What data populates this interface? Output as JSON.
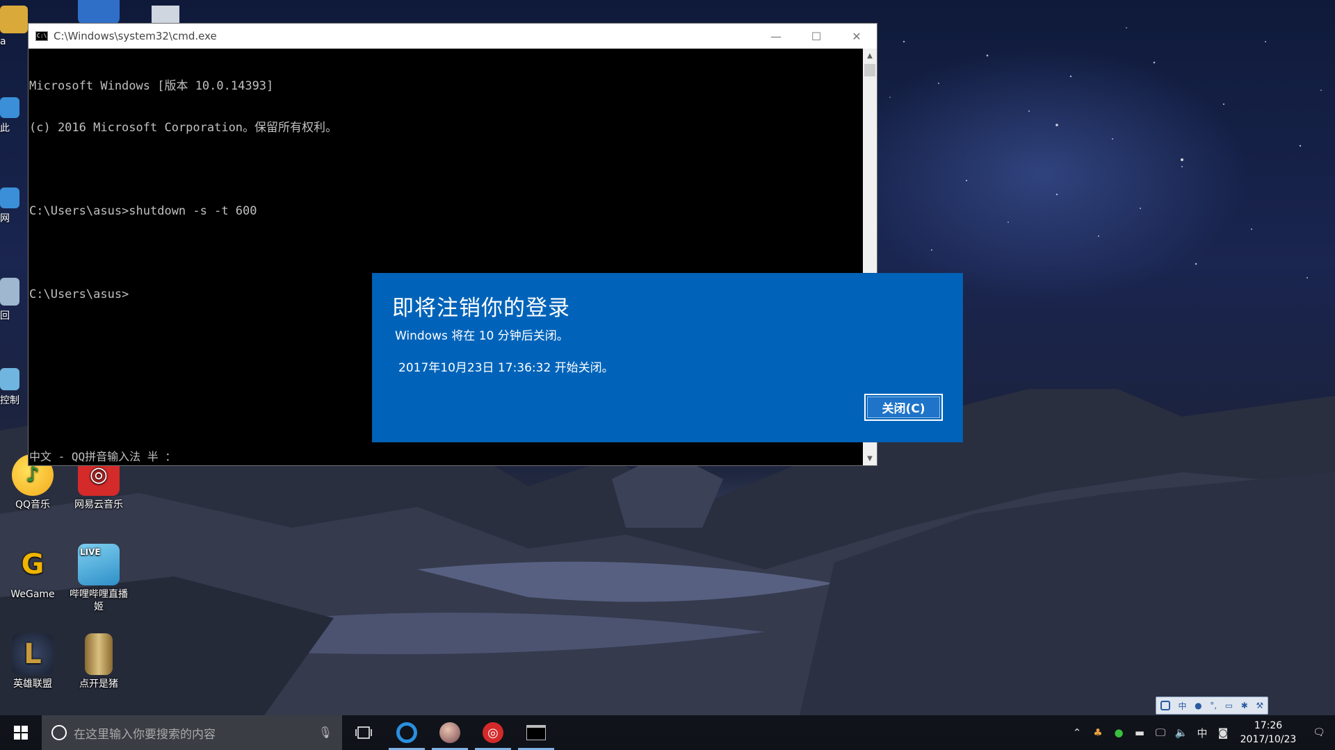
{
  "cmd_window": {
    "title": "C:\\Windows\\system32\\cmd.exe",
    "lines": [
      "Microsoft Windows [版本 10.0.14393]",
      "(c) 2016 Microsoft Corporation。保留所有权利。",
      "",
      "C:\\Users\\asus>shutdown -s -t 600",
      "",
      "C:\\Users\\asus>"
    ],
    "ime_status": "中文 - QQ拼音输入法 半 ："
  },
  "dialog": {
    "title": "即将注销你的登录",
    "message": "Windows 将在 10 分钟后关闭。",
    "time_message": "2017年10月23日 17:36:32 开始关闭。",
    "close_button": "关闭(C)",
    "background_color": "#0063b9"
  },
  "desktop_icons": [
    {
      "label": "QQ音乐",
      "icon": "qq-music-icon",
      "color": "#f4c21b"
    },
    {
      "label": "网易云音乐",
      "icon": "netease-music-icon",
      "color": "#d42a2a"
    },
    {
      "label": "WeGame",
      "icon": "wegame-icon",
      "color": "#f0b400"
    },
    {
      "label": "哔哩哔哩直播姬",
      "icon": "bilibili-live-icon",
      "color": "#3fa9d8"
    },
    {
      "label": "英雄联盟",
      "icon": "league-of-legends-icon",
      "color": "#c89b3c"
    },
    {
      "label": "点开是猪",
      "icon": "winrar-archive-icon",
      "color": "#b89a4a"
    }
  ],
  "partial_icons": [
    {
      "label": "a",
      "icon": "folder-icon"
    },
    {
      "label": "此",
      "icon": "this-pc-icon"
    },
    {
      "label": "网",
      "icon": "network-icon"
    },
    {
      "label": "回",
      "icon": "recycle-bin-icon"
    },
    {
      "label": "控制",
      "icon": "control-panel-icon"
    }
  ],
  "taskbar": {
    "search_placeholder": "在这里输入你要搜索的内容",
    "apps": [
      {
        "name": "task-view-button",
        "icon": "task-view-icon"
      },
      {
        "name": "taskbar-qq-browser",
        "icon": "qq-browser-icon"
      },
      {
        "name": "taskbar-avatar-app",
        "icon": "avatar-app-icon"
      },
      {
        "name": "taskbar-netease-music",
        "icon": "netease-music-icon"
      },
      {
        "name": "taskbar-cmd",
        "icon": "cmd-icon"
      }
    ],
    "tray": {
      "ime": "中",
      "time": "17:26",
      "date": "2017/10/23"
    }
  },
  "langbar": {
    "ime": "中"
  }
}
